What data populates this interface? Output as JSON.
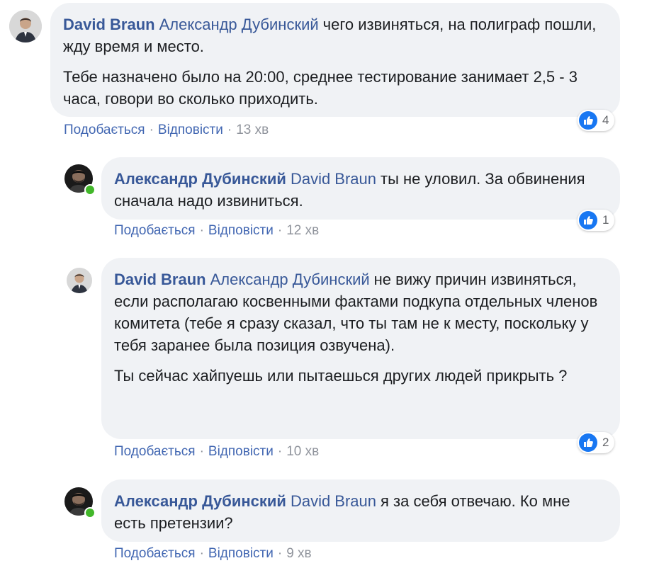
{
  "comments": [
    {
      "author": "David Braun",
      "mention": "Александр Дубинский",
      "paragraphs": [
        "чего извиняться, на полиграф пошли, жду время и место.",
        "Тебе назначено было на 20:00, среднее тестирование занимает 2,5 - 3 часа, говори во сколько приходить."
      ],
      "like_label": "Подобається",
      "reply_label": "Відповісти",
      "time": "13 хв",
      "reactions": "4",
      "reaction_icon": "like-icon",
      "online": false
    },
    {
      "author": "Александр Дубинский",
      "mention": "David Braun",
      "paragraphs": [
        "ты не уловил. За обвинения сначала надо извиниться."
      ],
      "like_label": "Подобається",
      "reply_label": "Відповісти",
      "time": "12 хв",
      "reactions": "1",
      "reaction_icon": "like-icon",
      "online": true
    },
    {
      "author": "David Braun",
      "mention": "Александр Дубинский",
      "paragraphs": [
        "не вижу причин извиняться, если располагаю косвенными фактами подкупа отдельных членов комитета (тебе я сразу сказал, что ты там не к месту, поскольку у тебя заранее была позиция озвучена).",
        "Ты сейчас хайпуешь или пытаешься других людей прикрыть ?"
      ],
      "like_label": "Подобається",
      "reply_label": "Відповісти",
      "time": "10 хв",
      "reactions": "2",
      "reaction_icon": "like-icon",
      "online": false
    },
    {
      "author": "Александр Дубинский",
      "mention": "David Braun",
      "paragraphs": [
        "я за себя отвечаю. Ко мне есть претензии?"
      ],
      "like_label": "Подобається",
      "reply_label": "Відповісти",
      "time": "9 хв",
      "reactions": "",
      "reaction_icon": "",
      "online": true
    }
  ],
  "colors": {
    "link": "#385898",
    "bubble": "#f0f2f5",
    "like": "#1877f2",
    "online": "#42b72a"
  }
}
